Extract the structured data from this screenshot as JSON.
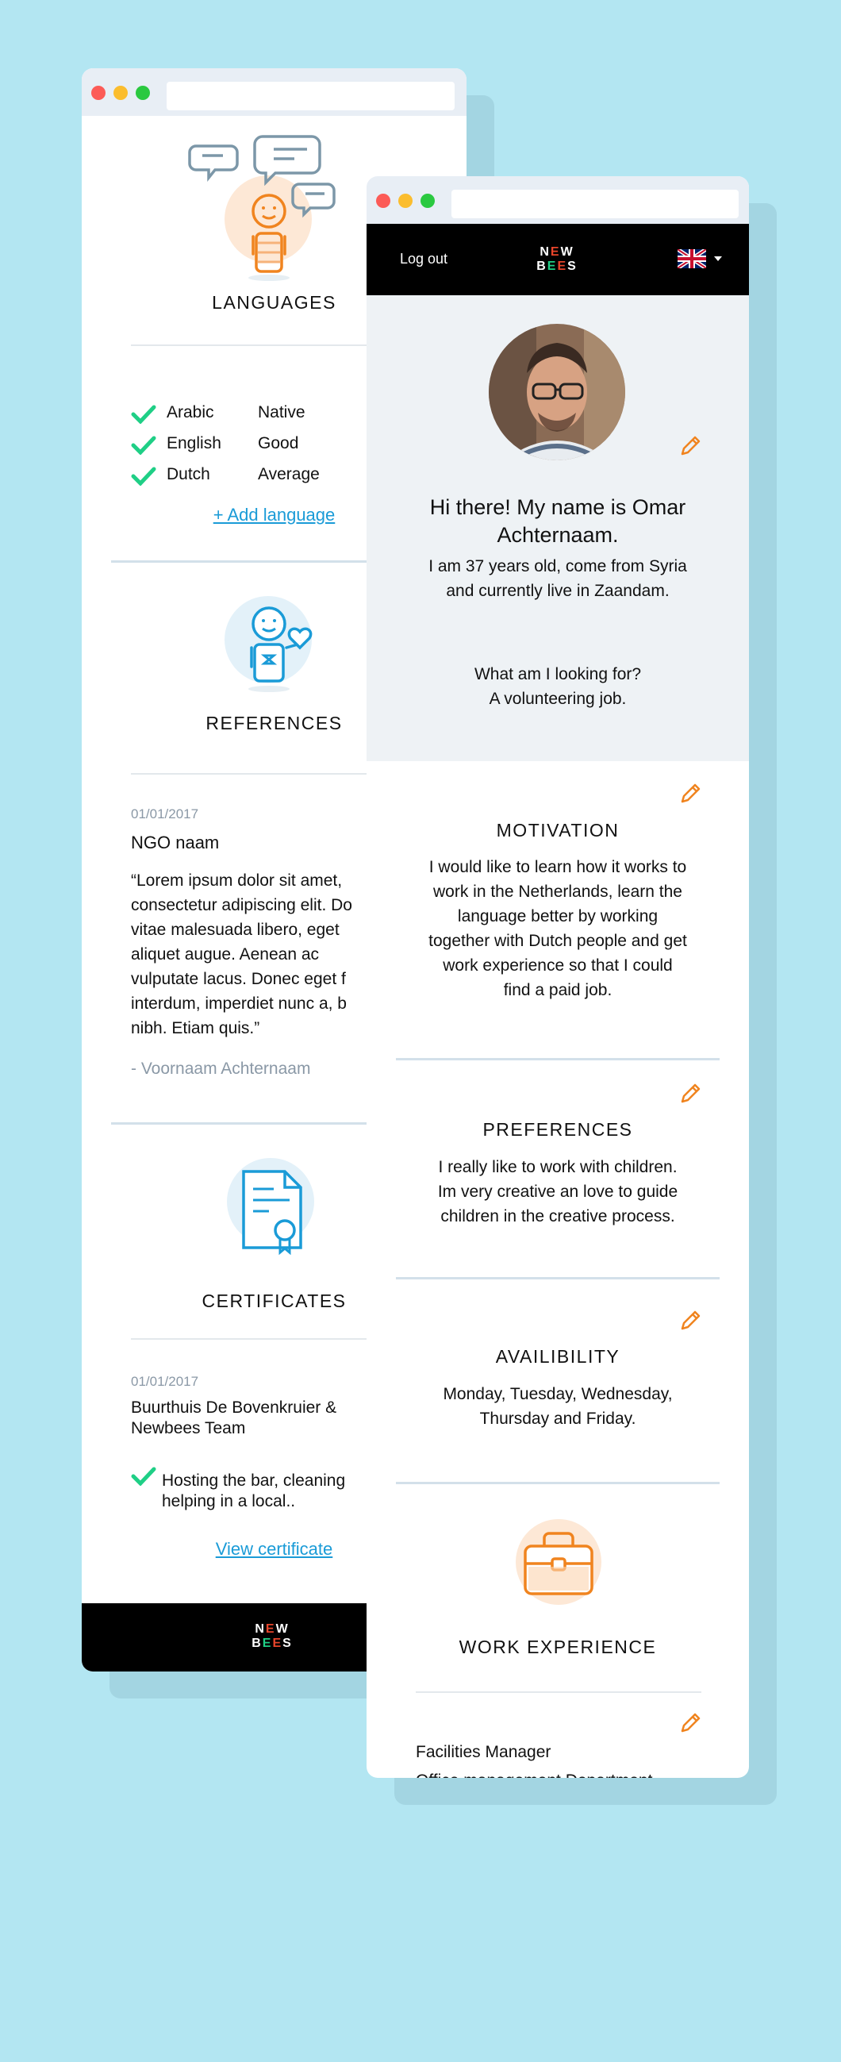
{
  "back_window": {
    "languages": {
      "title": "LANGUAGES",
      "items": [
        {
          "language": "Arabic",
          "level": "Native"
        },
        {
          "language": "English",
          "level": "Good"
        },
        {
          "language": "Dutch",
          "level": "Average"
        }
      ],
      "add_link": "+ Add  language"
    },
    "references": {
      "title": "REFERENCES",
      "date": "01/01/2017",
      "org": "NGO naam",
      "quote_lines": [
        "“Lorem ipsum dolor sit amet,",
        "consectetur adipiscing elit. Do",
        "vitae malesuada libero, eget",
        "aliquet augue. Aenean ac",
        "vulputate lacus. Donec eget f",
        "interdum, imperdiet nunc a, b",
        "nibh. Etiam quis.”"
      ],
      "author": "- Voornaam Achternaam"
    },
    "certificates": {
      "title": "CERTIFICATES",
      "date": "01/01/2017",
      "org_lines": [
        "Buurthuis De Bovenkruier &",
        "Newbees Team"
      ],
      "item_lines": [
        "Hosting the bar, cleaning",
        "helping in a local.."
      ],
      "view_link": "View certificate"
    },
    "footer_logo": {
      "line1": [
        "N",
        "E",
        "W"
      ],
      "line2": [
        "B",
        "E",
        "E",
        "S"
      ]
    }
  },
  "front_window": {
    "header": {
      "logout_label": "Log out",
      "logo": {
        "line1": [
          "N",
          "E",
          "W"
        ],
        "line2": [
          "B",
          "E",
          "E",
          "S"
        ]
      },
      "language_flag": "uk-flag-icon",
      "dropdown_icon": "caret-down-icon"
    },
    "profile": {
      "greeting_lines": [
        "Hi there! My name is Omar",
        "Achternaam."
      ],
      "intro_lines": [
        "I am 37 years old, come from Syria",
        "and currently live in Zaandam."
      ],
      "looking_for_lines": [
        "What am I looking for?",
        "A volunteering job."
      ]
    },
    "motivation": {
      "title": "MOTIVATION",
      "lines": [
        "I would like to learn how it works to",
        "work in the Netherlands, learn the",
        "language better by working",
        "together with Dutch people and get",
        "work experience so that I could",
        "find a paid job."
      ]
    },
    "preferences": {
      "title": "PREFERENCES",
      "lines": [
        "I really like to work with children.",
        "Im very creative an love to guide",
        "children in the creative process."
      ]
    },
    "availability": {
      "title": "AVAILIBILITY",
      "lines": [
        "Monday, Tuesday, Wednesday,",
        "Thursday and Friday."
      ]
    },
    "work_experience": {
      "title": "WORK EXPERIENCE",
      "job_title": "Facilities Manager",
      "cut_line": "Office management Department"
    }
  },
  "colors": {
    "background": "#b3e6f2",
    "accent_orange": "#f0841f",
    "accent_blue": "#1a9bd7",
    "check_green": "#1fcf86",
    "header_black": "#000000"
  }
}
